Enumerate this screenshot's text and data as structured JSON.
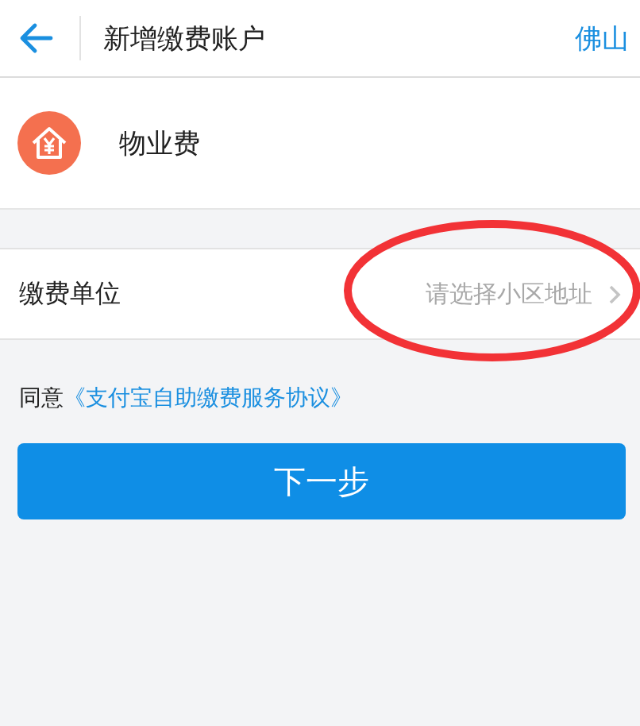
{
  "header": {
    "title": "新增缴费账户",
    "city": "佛山"
  },
  "category": {
    "label": "物业费"
  },
  "fields": [
    {
      "label": "缴费单位",
      "hint": "请选择小区地址"
    }
  ],
  "agreement": {
    "prefix": "同意",
    "link": "《支付宝自助缴费服务协议》"
  },
  "buttons": [
    "下一步"
  ]
}
